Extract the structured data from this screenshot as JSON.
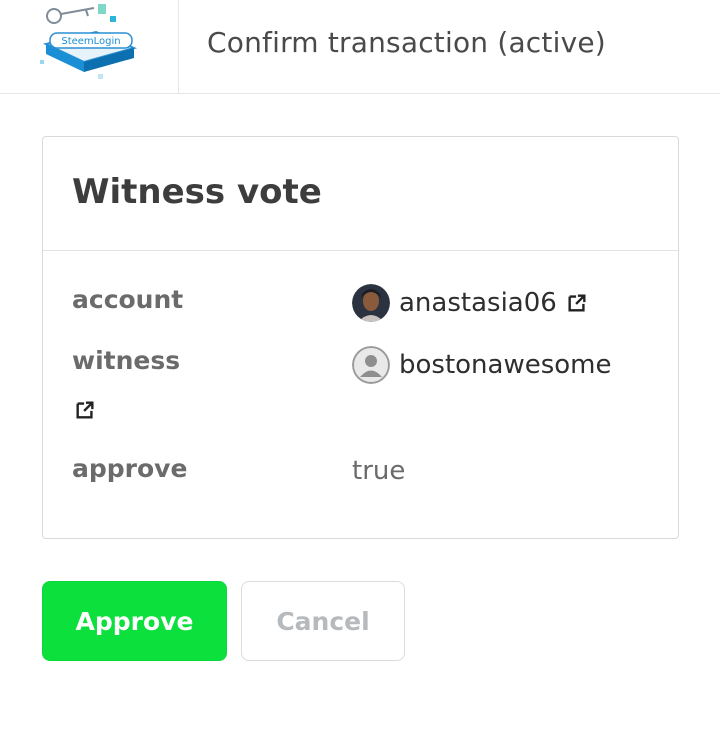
{
  "header": {
    "logo_text": "SteemLogin",
    "title": "Confirm transaction (active)"
  },
  "card": {
    "title": "Witness vote",
    "rows": {
      "account": {
        "label": "account",
        "value": "anastasia06"
      },
      "witness": {
        "label": "witness",
        "value": "bostonawesome"
      },
      "approve": {
        "label": "approve",
        "value": "true"
      }
    }
  },
  "buttons": {
    "approve": "Approve",
    "cancel": "Cancel"
  },
  "colors": {
    "approve_bg": "#0be03c",
    "cancel_text": "#b6babd",
    "logo_accent": "#1a8fd6"
  }
}
